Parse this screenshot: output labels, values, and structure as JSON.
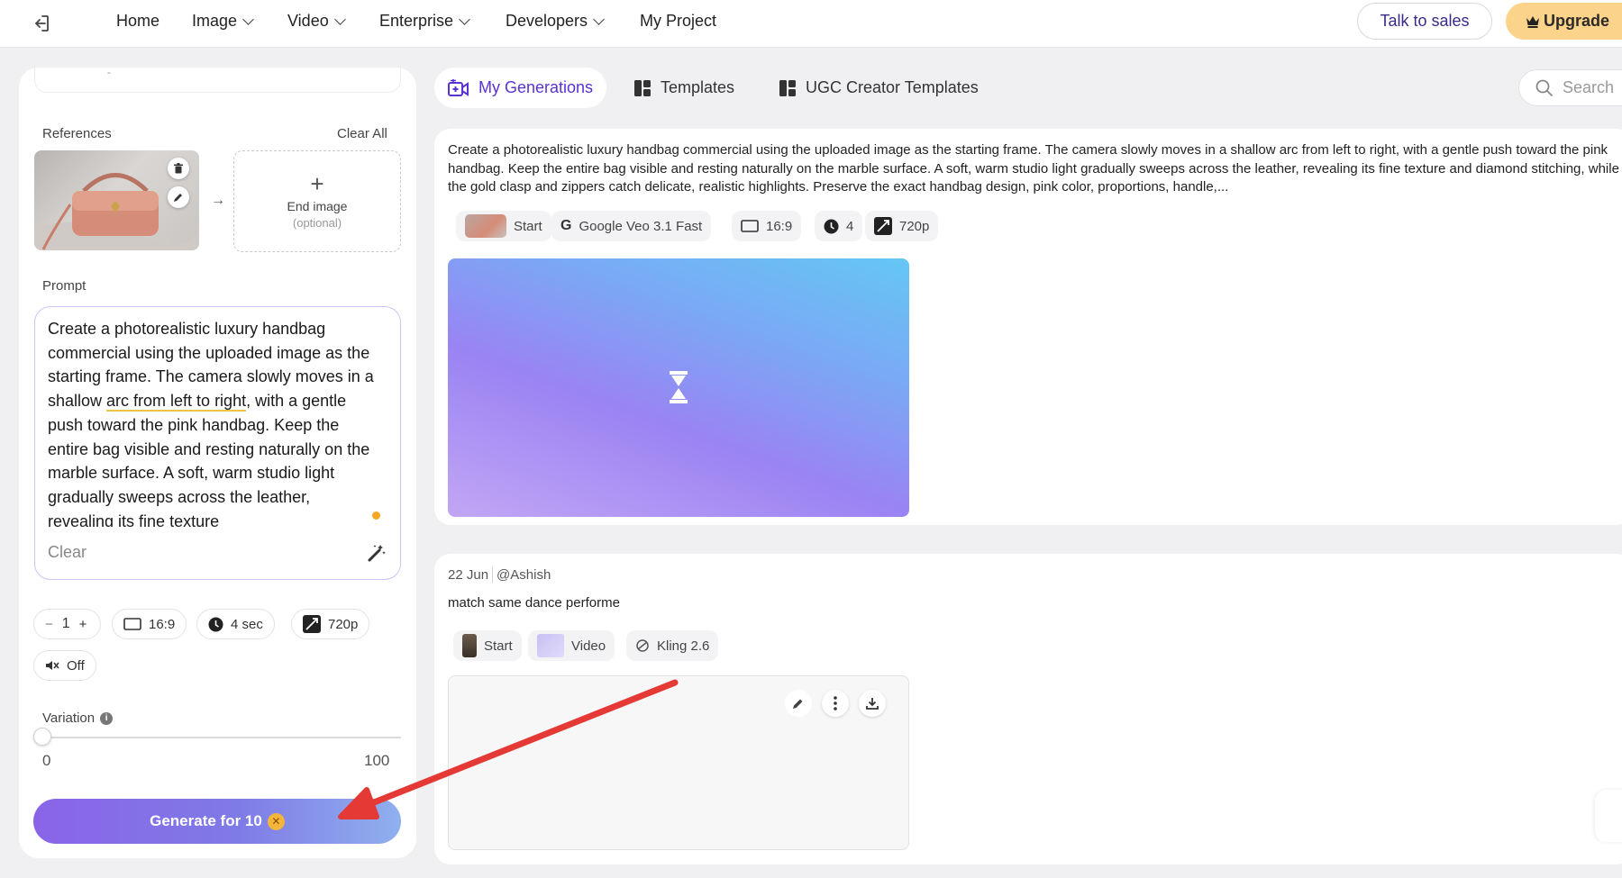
{
  "nav": {
    "items": [
      {
        "label": "Home",
        "dropdown": false
      },
      {
        "label": "Image",
        "dropdown": true
      },
      {
        "label": "Video",
        "dropdown": true
      },
      {
        "label": "Enterprise",
        "dropdown": true
      },
      {
        "label": "Developers",
        "dropdown": true
      },
      {
        "label": "My Project",
        "dropdown": false
      }
    ],
    "talk_to_sales": "Talk to sales",
    "upgrade": "Upgrade"
  },
  "left": {
    "references_label": "References",
    "clear_all": "Clear All",
    "end_image_title": "End image",
    "end_image_sub": "(optional)",
    "prompt_label": "Prompt",
    "prompt_text_1": "Create a photorealistic luxury handbag commercial using the uploaded image as the starting frame. The camera slowly moves in a shallow ",
    "prompt_underlined": "arc from left to right",
    "prompt_text_2": ", with a gentle push toward the pink handbag. Keep the entire bag visible and resting naturally on the marble surface. A soft, warm studio light gradually sweeps across the leather, revealing its fine texture",
    "prompt_clear": "Clear",
    "count": "1",
    "count_minus": "−",
    "count_plus": "+",
    "aspect": "16:9",
    "duration": "4 sec",
    "resolution": "720p",
    "audio": "Off",
    "variation_label": "Variation",
    "variation_value": 0,
    "slider_min": "0",
    "slider_max": "100",
    "generate_label": "Generate for 10"
  },
  "tabs": [
    {
      "label": "My Generations",
      "active": true,
      "icon": "video-plus-icon"
    },
    {
      "label": "Templates",
      "active": false,
      "icon": "template-grid-icon"
    },
    {
      "label": "UGC Creator Templates",
      "active": false,
      "icon": "template-grid-icon"
    }
  ],
  "search_placeholder": "Search",
  "generation_1": {
    "description": "Create a photorealistic luxury handbag commercial using the uploaded image as the starting frame. The camera slowly moves in a shallow arc from left to right, with a gentle push toward the pink handbag. Keep the entire bag visible and resting naturally on the marble surface. A soft, warm studio light gradually sweeps across the leather, revealing its fine texture and diamond stitching, while the gold clasp and zippers catch delicate, realistic highlights. Preserve the exact handbag design, pink color, proportions, handle,...",
    "start_label": "Start",
    "model": "Google Veo 3.1 Fast",
    "aspect": "16:9",
    "duration": "4",
    "resolution": "720p"
  },
  "generation_2": {
    "date": "22 Jun",
    "user": "@Ashish",
    "description": "match same dance performe",
    "start_label": "Start",
    "video_label": "Video",
    "model": "Kling 2.6"
  },
  "colors": {
    "accent": "#5a32d4",
    "upgrade_bg": "#fcd38a",
    "generate_gradient_start": "#8a64e8",
    "generate_gradient_end": "#8fb0ee",
    "annotation_arrow": "#e53935"
  }
}
